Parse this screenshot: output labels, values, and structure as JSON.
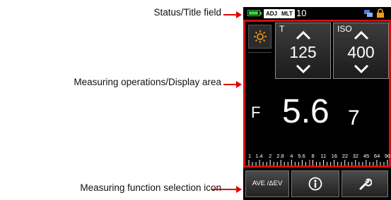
{
  "annotations": {
    "status_title": "Status/Title field",
    "measuring_display": "Measuring operations/Display area",
    "function_icon": "Measuring function selection icon"
  },
  "status_bar": {
    "adj_tag": "ADJ",
    "mlt_tag": "MLT",
    "number": "10",
    "icons": [
      "battery-icon",
      "signal-icon",
      "lock-icon"
    ]
  },
  "measure": {
    "mode_icon": "sun-icon",
    "shutter": {
      "label": "T",
      "value": "125"
    },
    "iso": {
      "label": "ISO",
      "value": "400"
    },
    "aperture": {
      "label": "F",
      "value": "5.6",
      "tenths": "7"
    },
    "scale_labels": [
      "1",
      "1.4",
      "2",
      "2.8",
      "4",
      "5.6",
      "8",
      "11",
      "16",
      "22",
      "32",
      "45",
      "64",
      "90"
    ]
  },
  "function_bar": {
    "ave_label": "AVE /ΔEV",
    "info_icon": "info-icon",
    "tool_icon": "wrench-icon"
  },
  "colors": {
    "frame_red": "#d21010",
    "battery_green": "#3fcf3f",
    "sun_orange": "#f0a020",
    "lock_orange": "#f0a020",
    "scale_marker": "#e03030"
  }
}
